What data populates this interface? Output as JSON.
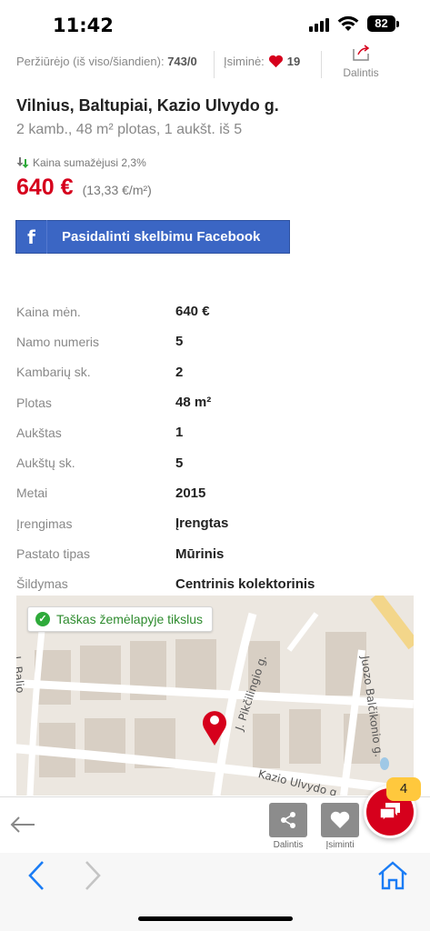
{
  "status_bar": {
    "time": "11:42",
    "battery": "82"
  },
  "stats": {
    "views_label": "Peržiūrėjo (iš viso/šiandien):",
    "views_value": "743/0",
    "saved_label": "Įsiminė:",
    "saved_value": "19",
    "share_label": "Dalintis"
  },
  "listing": {
    "title": "Vilnius, Baltupiai, Kazio Ulvydo g.",
    "subtitle": "2 kamb., 48 m² plotas, 1 aukšt. iš 5",
    "price_drop": "Kaina sumažėjusi 2,3%",
    "price": "640 €",
    "price_per_m2": "(13,33 €/m²)"
  },
  "facebook_button": {
    "label": "Pasidalinti skelbimu Facebook"
  },
  "details": [
    {
      "key": "Kaina mėn.",
      "value": "640 €"
    },
    {
      "key": "Namo numeris",
      "value": "5"
    },
    {
      "key": "Kambarių sk.",
      "value": "2"
    },
    {
      "key": "Plotas",
      "value": "48 m²"
    },
    {
      "key": "Aukštas",
      "value": "1"
    },
    {
      "key": "Aukštų sk.",
      "value": "5"
    },
    {
      "key": "Metai",
      "value": "2015"
    },
    {
      "key": "Įrengimas",
      "value": "Įrengtas"
    },
    {
      "key": "Pastato tipas",
      "value": "Mūrinis"
    },
    {
      "key": "Šildymas",
      "value": "Centrinis kolektorinis"
    }
  ],
  "map": {
    "badge": "Taškas žemėlapyje tikslus",
    "streets": [
      "J. Pikčilingio g.",
      "Juozo Balčikonio g.",
      "Kazio Ulvydo g.",
      "J. Balio"
    ]
  },
  "toolbar": {
    "share_label": "Dalintis",
    "save_label": "Įsiminti",
    "chat_count": "4"
  },
  "colors": {
    "accent": "#d6001c",
    "facebook": "#3b66c4",
    "browser_icons": "#1a7cf5"
  }
}
